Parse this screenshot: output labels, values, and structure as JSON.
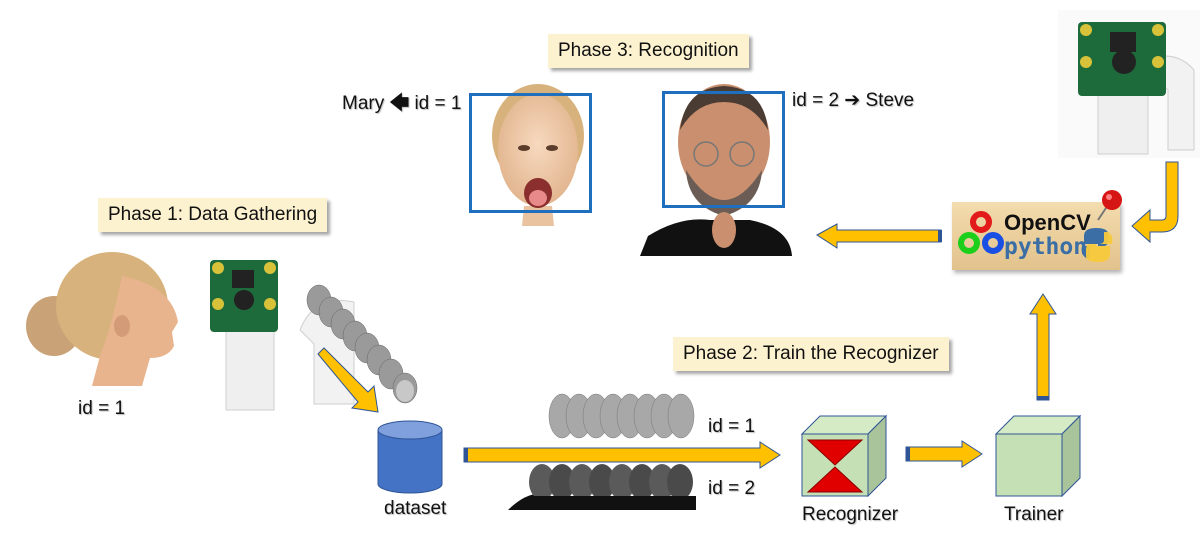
{
  "diagram": {
    "phases": {
      "phase1": "Phase 1: Data Gathering",
      "phase2": "Phase 2: Train the Recognizer",
      "phase3": "Phase 3: Recognition"
    },
    "recognition": {
      "left_result": "Mary ← id = 1",
      "left_name": "Mary",
      "left_id": "id = 1",
      "right_result": "id = 2 → Steve",
      "right_id": "id = 2",
      "right_name": "Steve",
      "arrow_left_glyph": "🡄",
      "arrow_right_glyph": "➔"
    },
    "gathering": {
      "subject_id": "id = 1",
      "dataset_label": "dataset"
    },
    "training": {
      "group1_id": "id = 1",
      "group2_id": "id = 2",
      "recognizer_label": "Recognizer",
      "trainer_label": "Trainer"
    },
    "library": {
      "name1": "OpenCV",
      "name2": "python"
    },
    "colors": {
      "arrow_fill": "#ffc000",
      "arrow_stroke": "#2f5597",
      "face_box": "#1f6fbf",
      "label_bg": "#fdf2d0",
      "cube_face": "#c5e0b4",
      "cube_side": "#a9c49a",
      "dataset_blue": "#4472c4",
      "hourglass_red": "#e00000"
    }
  }
}
